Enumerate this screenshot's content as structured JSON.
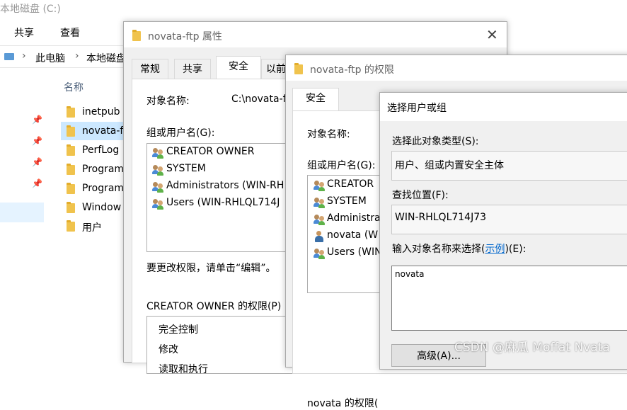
{
  "explorer": {
    "title": "本地磁盘 (C:)",
    "ribbon_tabs": [
      "共享",
      "查看"
    ],
    "breadcrumb": [
      "此电脑",
      "本地磁盘"
    ],
    "column_name": "名称",
    "items": [
      "inetpub",
      "novata-f",
      "PerfLog",
      "Program",
      "Program",
      "Window",
      "用户"
    ]
  },
  "props_dialog": {
    "title": "novata-ftp 属性",
    "tabs": [
      "常规",
      "共享",
      "安全",
      "以前"
    ],
    "object_label": "对象名称:",
    "object_value": "C:\\novata-f",
    "group_label": "组或用户名(G):",
    "users": [
      "CREATOR OWNER",
      "SYSTEM",
      "Administrators (WIN-RH",
      "Users (WIN-RHLQL714J"
    ],
    "edit_hint": "要更改权限，请单击“编辑”。",
    "perm_label": "CREATOR OWNER 的权限(P)",
    "perms": [
      "完全控制",
      "修改",
      "读取和执行"
    ]
  },
  "perm_dialog": {
    "title": "novata-ftp 的权限",
    "tab": "安全",
    "object_label": "对象名称:",
    "group_label": "组或用户名(G):",
    "users": [
      "CREATOR",
      "SYSTEM",
      "Administra",
      "novata (W",
      "Users (WIN"
    ],
    "perm_label": "novata 的权限("
  },
  "select_dialog": {
    "title": "选择用户或组",
    "type_label": "选择此对象类型(S):",
    "type_value": "用户、组或内置安全主体",
    "location_label": "查找位置(F):",
    "location_value": "WIN-RHLQL714J73",
    "input_label_prefix": "输入对象名称来选择(",
    "input_label_link": "示例",
    "input_label_suffix": ")(E):",
    "input_value": "novata",
    "advanced_button": "高级(A)..."
  },
  "watermark": "CSDN @麻瓜 Moffat Nvata"
}
